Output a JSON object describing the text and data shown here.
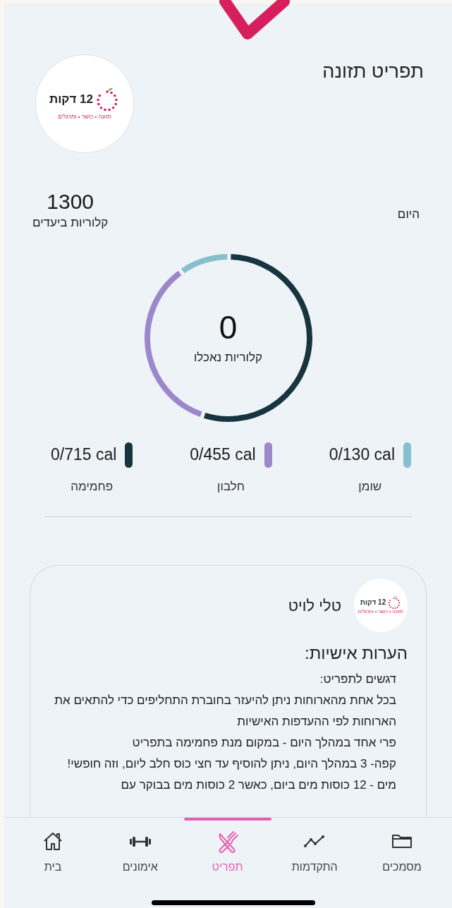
{
  "header": {
    "title": "תפריט תזונה",
    "logo": {
      "brand": "12 דקות",
      "tagline": "תזונה • כושר • ותרגלים"
    }
  },
  "summary": {
    "day_label": "היום",
    "goal_value": "1300",
    "goal_label": "קלוריות ביעדים",
    "eaten_value": "0",
    "eaten_label": "קלוריות נאכלו"
  },
  "macros": [
    {
      "name": "שומן",
      "reading": "0/130 cal",
      "color": "#86c0cc"
    },
    {
      "name": "חלבון",
      "reading": "0/455 cal",
      "color": "#9b87c9"
    },
    {
      "name": "פחמימה",
      "reading": "0/715 cal",
      "color": "#17343f"
    }
  ],
  "notes_card": {
    "author": "טלי לויט",
    "logo": {
      "brand": "12 דקות",
      "tagline": "תזונה • כושר • ותרגלים"
    },
    "heading": "הערות אישיות:",
    "lines": [
      "דגשים לתפריט:",
      "בכל אחת מהארוחות ניתן להיעזר בחוברת התחליפים כדי להתאים את הארוחות לפי ההעדפות האישיות",
      "פרי אחד במהלך היום - במקום מנת פחמימה בתפריט",
      "קפה- 3 במהלך היום, ניתן להוסיף עד חצי כוס חלב ליום, וזה חופשי!",
      "מים - 12 כוסות מים ביום, כאשר 2 כוסות מים בבוקר עם"
    ]
  },
  "bottom_nav": [
    {
      "kind": "folder",
      "label": "מסמכים",
      "selected": false
    },
    {
      "kind": "chart",
      "label": "התקדמות",
      "selected": false
    },
    {
      "kind": "menu",
      "label": "תפריט",
      "selected": true
    },
    {
      "kind": "workouts",
      "label": "אימונים",
      "selected": false
    },
    {
      "kind": "home",
      "label": "בית",
      "selected": false
    }
  ]
}
